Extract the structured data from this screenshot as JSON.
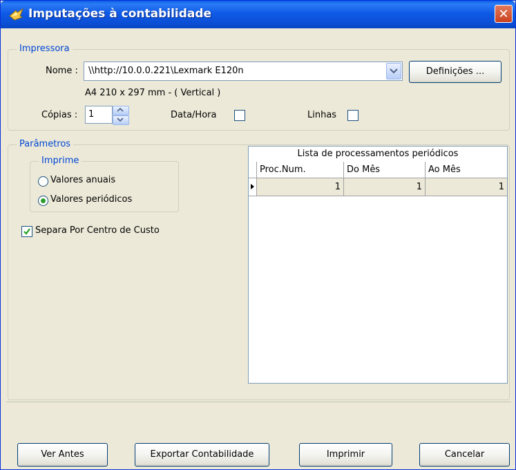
{
  "window": {
    "title": "Imputações à contabilidade",
    "close_glyph": "✕"
  },
  "printer": {
    "legend": "Impressora",
    "name_label": "Nome :",
    "name_value": "\\\\http://10.0.0.221\\Lexmark E120n",
    "settings_label": "Definições ...",
    "paper_info": "A4 210 x 297 mm  -  ( Vertical )",
    "copies_label": "Cópias :",
    "copies_value": "1",
    "datetime_label": "Data/Hora",
    "lines_label": "Linhas"
  },
  "params": {
    "legend": "Parâmetros",
    "print_legend": "Imprime",
    "annual_label": "Valores anuais",
    "periodic_label": "Valores periódicos",
    "separate_label": "Separa Por Centro de Custo"
  },
  "grid": {
    "caption": "Lista de processamentos periódicos",
    "headers": [
      "Proc.Num.",
      "Do Mês",
      "Ao Mês"
    ],
    "rows": [
      [
        "1",
        "1",
        "1"
      ]
    ]
  },
  "buttons": {
    "preview": "Ver Antes",
    "export": "Exportar Contabilidade",
    "print": "Imprimir",
    "cancel": "Cancelar"
  },
  "colors": {
    "titlebar": "#0b4fd6",
    "legend_text": "#0046d5",
    "dialog_bg": "#ece9d8"
  }
}
